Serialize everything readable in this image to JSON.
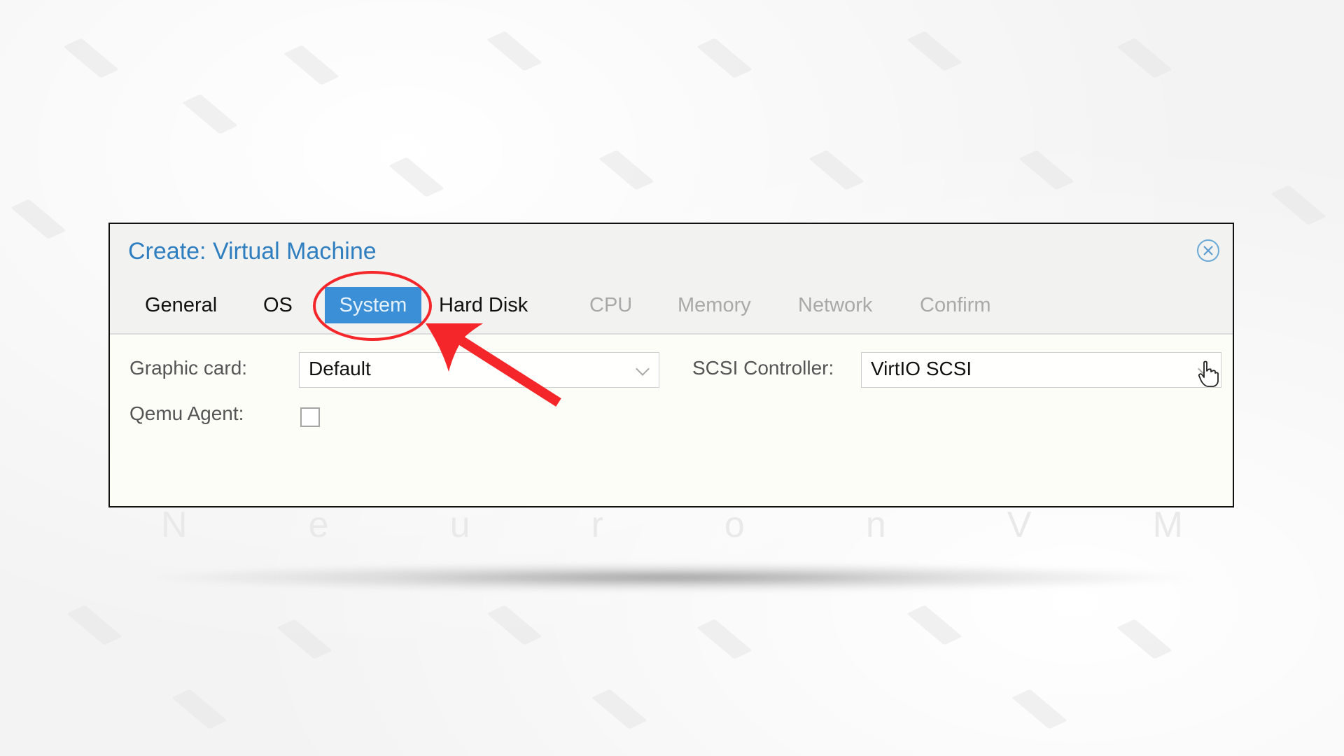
{
  "dialog": {
    "title": "Create: Virtual Machine",
    "close_icon": "close-circle-icon",
    "tabs": [
      {
        "label": "General",
        "state": "enabled"
      },
      {
        "label": "OS",
        "state": "enabled"
      },
      {
        "label": "System",
        "state": "active"
      },
      {
        "label": "Hard Disk",
        "state": "enabled"
      },
      {
        "label": "CPU",
        "state": "disabled"
      },
      {
        "label": "Memory",
        "state": "disabled"
      },
      {
        "label": "Network",
        "state": "disabled"
      },
      {
        "label": "Confirm",
        "state": "disabled"
      }
    ],
    "form": {
      "graphic_card_label": "Graphic card:",
      "graphic_card_value": "Default",
      "qemu_agent_label": "Qemu Agent:",
      "qemu_agent_checked": false,
      "scsi_controller_label": "SCSI Controller:",
      "scsi_controller_value": "VirtIO SCSI"
    }
  },
  "annotation": {
    "highlight": "red-ellipse-around-system-tab",
    "arrow": "red-arrow-pointing-to-system-tab",
    "color": "#f5262a"
  },
  "cursor": "hand-pointer-icon",
  "watermark": [
    "N",
    "e",
    "u",
    "r",
    "o",
    "n",
    "V",
    "M"
  ],
  "colors": {
    "title": "#2f7fc0",
    "active_tab": "#3a8fd6",
    "disabled_tab": "#a9a9a9"
  }
}
